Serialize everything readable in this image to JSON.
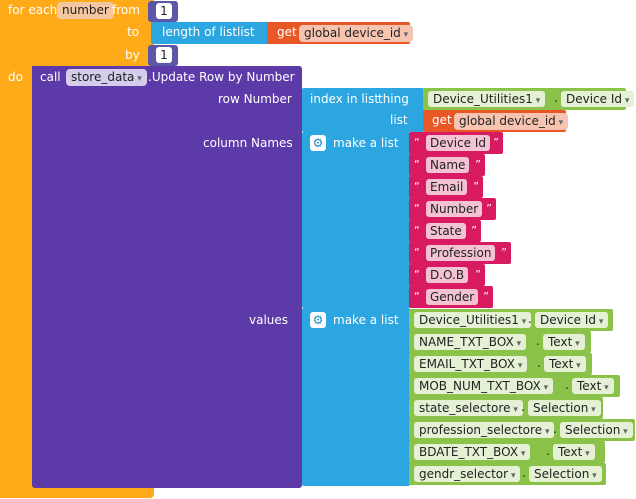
{
  "for_each": {
    "for_each_label": "for each",
    "var_name": "number",
    "from_label": "from",
    "from_value": "1",
    "to_label": "to",
    "to_expr": {
      "prefix": "length of list",
      "list_label": "list",
      "get_label": "get",
      "var": "global device_id"
    },
    "by_label": "by",
    "by_value": "1",
    "do_label": "do"
  },
  "call_block": {
    "call_label": "call",
    "component": "store_data",
    "method": ".Update Row by Number",
    "row_number_label": "row Number",
    "index_in_list": {
      "label": "index in list",
      "thing_label": "thing",
      "component": "Device_Utilities1",
      "property": "Device Id",
      "list_label": "list",
      "get_label": "get",
      "var": "global device_id"
    },
    "column_names_label": "column Names",
    "make_list_label": "make a list",
    "columns": [
      "Device Id",
      "Name",
      "Email",
      "Number",
      "State",
      "Profession",
      "D.O.B",
      "Gender"
    ],
    "values_label": "values",
    "values_make_list_label": "make a list",
    "values": [
      {
        "component": "Device_Utilities1",
        "property": "Device Id"
      },
      {
        "component": "NAME_TXT_BOX",
        "property": "Text"
      },
      {
        "component": "EMAIL_TXT_BOX",
        "property": "Text"
      },
      {
        "component": "MOB_NUM_TXT_BOX",
        "property": "Text"
      },
      {
        "component": "state_selectore",
        "property": "Selection"
      },
      {
        "component": "profession_selectore",
        "property": "Selection"
      },
      {
        "component": "BDATE_TXT_BOX",
        "property": "Text"
      },
      {
        "component": "gendr_selector",
        "property": "Selection"
      }
    ]
  },
  "colors": {
    "control": "#ffab19",
    "procedure": "#5c3aa7",
    "list": "#2ca6e0",
    "variable": "#ea5727",
    "text": "#d81b60",
    "component": "#8bc34a",
    "math": "#5b56a8"
  }
}
